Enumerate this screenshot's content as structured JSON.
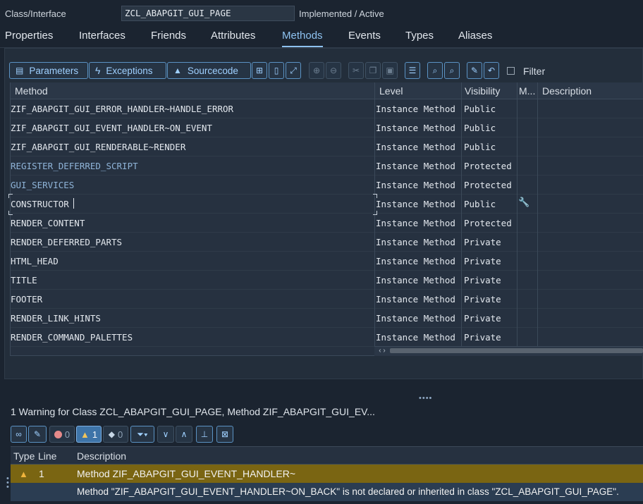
{
  "header": {
    "label": "Class/Interface",
    "class_name": "ZCL_ABAPGIT_GUI_PAGE",
    "status": "Implemented / Active"
  },
  "tabs": [
    {
      "label": "Properties"
    },
    {
      "label": "Interfaces"
    },
    {
      "label": "Friends"
    },
    {
      "label": "Attributes"
    },
    {
      "label": "Methods",
      "active": true
    },
    {
      "label": "Events"
    },
    {
      "label": "Types"
    },
    {
      "label": "Aliases"
    }
  ],
  "toolbar": {
    "parameters_label": "Parameters",
    "exceptions_label": "Exceptions",
    "sourcecode_label": "Sourcecode",
    "filter_label": "Filter"
  },
  "methods_table": {
    "columns": [
      "Method",
      "Level",
      "Visibility",
      "M...",
      "Description"
    ],
    "rows": [
      {
        "method": "ZIF_ABAPGIT_GUI_ERROR_HANDLER~HANDLE_ERROR",
        "level": "Instance Method",
        "visibility": "Public"
      },
      {
        "method": "ZIF_ABAPGIT_GUI_EVENT_HANDLER~ON_EVENT",
        "level": "Instance Method",
        "visibility": "Public"
      },
      {
        "method": "ZIF_ABAPGIT_GUI_RENDERABLE~RENDER",
        "level": "Instance Method",
        "visibility": "Public"
      },
      {
        "method": "REGISTER_DEFERRED_SCRIPT",
        "level": "Instance Method",
        "visibility": "Protected"
      },
      {
        "method": "GUI_SERVICES",
        "level": "Instance Method",
        "visibility": "Protected"
      },
      {
        "method": "CONSTRUCTOR",
        "level": "Instance Method",
        "visibility": "Public"
      },
      {
        "method": "RENDER_CONTENT",
        "level": "Instance Method",
        "visibility": "Protected"
      },
      {
        "method": "RENDER_DEFERRED_PARTS",
        "level": "Instance Method",
        "visibility": "Private"
      },
      {
        "method": "HTML_HEAD",
        "level": "Instance Method",
        "visibility": "Private"
      },
      {
        "method": "TITLE",
        "level": "Instance Method",
        "visibility": "Private"
      },
      {
        "method": "FOOTER",
        "level": "Instance Method",
        "visibility": "Private"
      },
      {
        "method": "RENDER_LINK_HINTS",
        "level": "Instance Method",
        "visibility": "Private"
      },
      {
        "method": "RENDER_COMMAND_PALETTES",
        "level": "Instance Method",
        "visibility": "Private"
      }
    ]
  },
  "messages": {
    "title": "1 Warning for Class ZCL_ABAPGIT_GUI_PAGE, Method ZIF_ABAPGIT_GUI_EV...",
    "error_count": "0",
    "warning_count": "1",
    "info_count": "0",
    "columns": [
      "Type",
      "Line",
      "Description"
    ],
    "rows": [
      {
        "line": "1",
        "description": "Method ZIF_ABAPGIT_GUI_EVENT_HANDLER~"
      },
      {
        "line": "",
        "description": "Method \"ZIF_ABAPGIT_GUI_EVENT_HANDLER~ON_BACK\" is not declared or inherited in class \"ZCL_ABAPGIT_GUI_PAGE\"."
      }
    ]
  },
  "colors": {
    "background": "#1b2430",
    "accent": "#8ec2f0",
    "warning_row": "#7a6512",
    "selected_row": "#2b3d52"
  }
}
